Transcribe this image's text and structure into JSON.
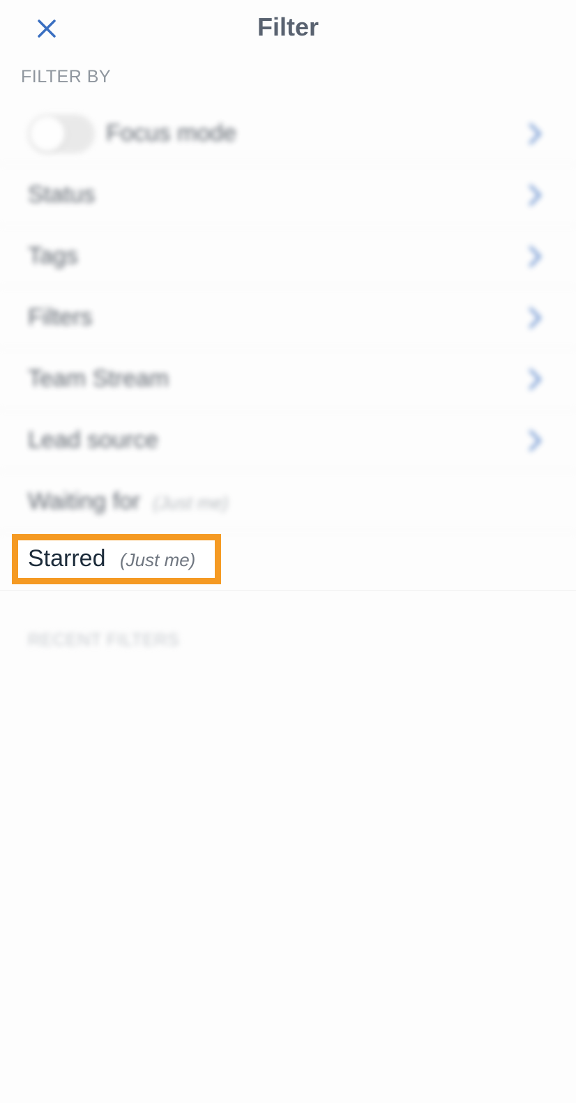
{
  "header": {
    "title": "Filter",
    "close_icon": "close-icon"
  },
  "filter_by": {
    "label": "FILTER BY",
    "rows": [
      {
        "label": "Focus mode",
        "has_toggle": true,
        "toggle_on": false
      },
      {
        "label": "Status"
      },
      {
        "label": "Tags"
      },
      {
        "label": "Filters"
      },
      {
        "label": "Team Stream"
      },
      {
        "label": "Lead source"
      },
      {
        "label": "Waiting for",
        "sub": "(Just me)"
      }
    ],
    "starred": {
      "label": "Starred",
      "sub": "(Just me)"
    }
  },
  "recent_filters": {
    "label": "RECENT FILTERS"
  },
  "colors": {
    "accent": "#3a6fc1",
    "highlight": "#f59a23",
    "title": "#596270"
  }
}
